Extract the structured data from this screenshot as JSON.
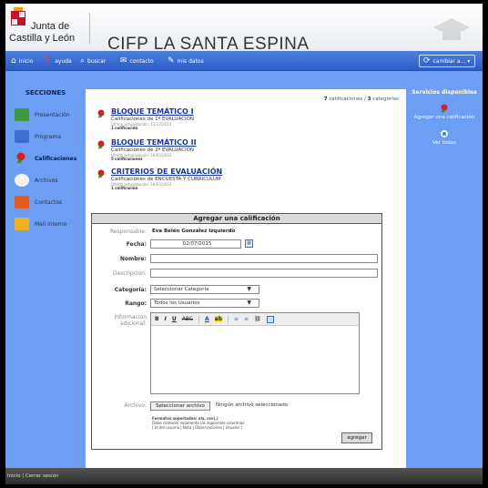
{
  "header": {
    "logo_line1": "Junta de",
    "logo_line2": "Castilla y León",
    "site_title": "CIFP LA SANTA ESPINA"
  },
  "nav": {
    "inicio": "inicio",
    "ayuda": "ayuda",
    "buscar": "buscar",
    "contacto": "contacto",
    "mis_datos": "mis datos",
    "cambiar": "cambiar a...",
    "accent": "#2c5cc5"
  },
  "sidebar": {
    "heading": "SECCIONES",
    "items": [
      {
        "label": "Presentación",
        "icon": "presentation-icon",
        "color": "#3c9a3c"
      },
      {
        "label": "Programa",
        "icon": "program-icon",
        "color": "#3b6fd0"
      },
      {
        "label": "Calificaciones",
        "icon": "ribbon-icon",
        "color": "#d42020"
      },
      {
        "label": "Archivos",
        "icon": "files-icon",
        "color": "#f0f0f0"
      },
      {
        "label": "Contactos",
        "icon": "contacts-icon",
        "color": "#e05a1a"
      },
      {
        "label": "Mail interno",
        "icon": "mail-icon",
        "color": "#f0b020"
      }
    ]
  },
  "summary": {
    "count_cal": "7",
    "label_cal": "calificaciones /",
    "count_cat": "3",
    "label_cat": "categorías"
  },
  "blocks": [
    {
      "title": "BLOQUE TEMÁTICO I",
      "subtitle": "Calificaciones de 1ª EVALUACIÓN",
      "meta": "Última actualización: 11/12/2014",
      "count": "1 calificación"
    },
    {
      "title": "BLOQUE TEMÁTICO II",
      "subtitle": "Calificaciones de 2ª EVALUACIÓN",
      "meta": "Última actualización: 16/03/2015",
      "count": "5 calificaciones"
    },
    {
      "title": "CRITERIOS DE EVALUACIÓN",
      "subtitle": "Calificaciones de ENCUESTA Y CURRICULUM",
      "meta": "Última actualización: 16/03/2015",
      "count": "1 calificación"
    }
  ],
  "form": {
    "heading": "Agregar una calificación",
    "responsable_label": "Responsable:",
    "responsable_value": "Eva Belén González Izquierdo",
    "fecha_label": "Fecha:",
    "fecha_value": "02/07/2015",
    "nombre_label": "Nombre:",
    "descripcion_label": "Descripción:",
    "categoria_label": "Categoría:",
    "categoria_value": "Seleccionar Categoría",
    "rango_label": "Rango:",
    "rango_value": "Todos los Usuarios",
    "info_label_1": "Información",
    "info_label_2": "adicional:",
    "archivo_label": "Archivo:",
    "file_button": "Seleccionar archivo",
    "file_status": "Ningún archivo seleccionado",
    "file_help_1": "Formatos soportados: xls, csv(,)",
    "file_help_2": "Debe contener solamente las siguientes columnas:",
    "file_help_3": "[ Id del usuario | Nota | Observaciones | Usuario ]",
    "submit": "agregar",
    "toolbar": [
      "B",
      "I",
      "U",
      "ABC",
      "A",
      "ab",
      "≡",
      "≡",
      "⛓"
    ]
  },
  "services": {
    "heading": "Servicios disponibles",
    "add_label": "Agregar una calificación",
    "view_label": "Ver todas"
  },
  "footer": {
    "text": "Inicio | Cerrar sesión"
  }
}
